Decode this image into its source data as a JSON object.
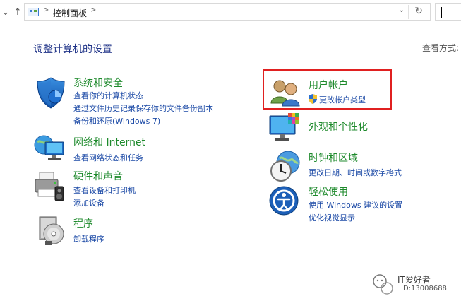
{
  "address_bar": {
    "breadcrumb": "控制面板",
    "separator": ">"
  },
  "title": "调整计算机的设置",
  "view_by_label": "查看方式:",
  "categories": [
    {
      "title": "系统和安全",
      "links": [
        "查看你的计算机状态",
        "通过文件历史记录保存你的文件备份副本",
        "备份和还原(Windows 7)"
      ]
    },
    {
      "title": "网络和 Internet",
      "links": [
        "查看网络状态和任务"
      ]
    },
    {
      "title": "硬件和声音",
      "links": [
        "查看设备和打印机",
        "添加设备"
      ]
    },
    {
      "title": "程序",
      "links": [
        "卸载程序"
      ]
    },
    {
      "title": "用户帐户",
      "links": [
        "更改帐户类型"
      ]
    },
    {
      "title": "外观和个性化",
      "links": []
    },
    {
      "title": "时钟和区域",
      "links": [
        "更改日期、时间或数字格式"
      ]
    },
    {
      "title": "轻松使用",
      "links": [
        "使用 Windows 建议的设置",
        "优化视觉显示"
      ]
    }
  ],
  "watermark": {
    "name": "IT爱好者",
    "id": "ID:13008688"
  },
  "colors": {
    "category_title": "#1e8a2c",
    "link": "#1c4aa6",
    "page_title": "#1e3287",
    "highlight": "#e02020"
  }
}
